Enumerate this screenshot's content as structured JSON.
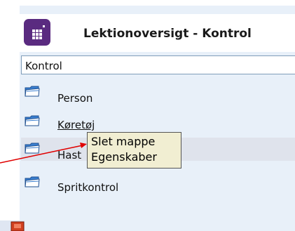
{
  "header": {
    "title": "Lektionoversigt - Kontrol",
    "icon": "grid-app-icon",
    "icon_color": "#5a2b80"
  },
  "filter": {
    "value": "Kontrol"
  },
  "items": [
    {
      "label": "Person",
      "icon": "folder-icon"
    },
    {
      "label": "Køretøj",
      "icon": "folder-icon"
    },
    {
      "label": "Hast",
      "icon": "folder-icon"
    },
    {
      "label": "Spritkontrol",
      "icon": "folder-icon"
    }
  ],
  "context_menu": {
    "items": [
      "Slet mappe",
      "Egenskaber"
    ]
  },
  "colors": {
    "panel": "#e8f0f9",
    "tooltip_bg": "#f1eed2",
    "arrow": "#e00000"
  }
}
